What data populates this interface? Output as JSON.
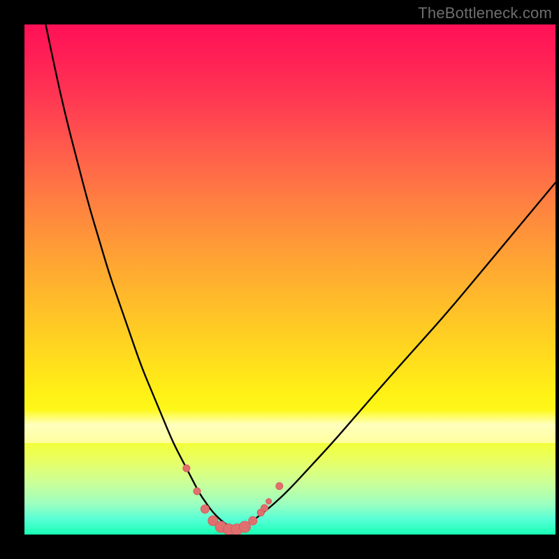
{
  "watermark": "TheBottleneck.com",
  "colors": {
    "background": "#000000",
    "curve": "#000000",
    "marker_fill": "#e07070",
    "marker_stroke": "#d85a5a"
  },
  "chart_data": {
    "type": "line",
    "title": "",
    "xlabel": "",
    "ylabel": "",
    "xlim": [
      0,
      100
    ],
    "ylim": [
      0,
      100
    ],
    "grid": false,
    "series": [
      {
        "name": "bottleneck-curve",
        "x": [
          4,
          6,
          8,
          10,
          12,
          14,
          16,
          18,
          20,
          22,
          24,
          26,
          28,
          30,
          31,
          32,
          33,
          34,
          35,
          36,
          37,
          38,
          39,
          40,
          41,
          42,
          44,
          47,
          50,
          54,
          58,
          63,
          68,
          74,
          80,
          86,
          92,
          98,
          100
        ],
        "y": [
          100,
          90,
          81,
          73,
          65,
          58,
          51,
          45,
          39,
          33,
          28,
          23,
          18,
          14,
          12,
          10,
          8,
          6.5,
          5,
          3.8,
          2.8,
          2.0,
          1.3,
          1.0,
          1.3,
          2.0,
          3.5,
          6,
          9,
          13.5,
          18,
          24,
          30,
          37,
          44,
          51.5,
          59,
          66.5,
          69
        ]
      }
    ],
    "markers": [
      {
        "x": 30.5,
        "y": 13.0,
        "r": 5
      },
      {
        "x": 32.5,
        "y": 8.5,
        "r": 5
      },
      {
        "x": 34.0,
        "y": 5.0,
        "r": 6
      },
      {
        "x": 35.5,
        "y": 2.7,
        "r": 7
      },
      {
        "x": 37.0,
        "y": 1.5,
        "r": 8
      },
      {
        "x": 38.5,
        "y": 1.0,
        "r": 8
      },
      {
        "x": 40.0,
        "y": 1.0,
        "r": 8
      },
      {
        "x": 41.5,
        "y": 1.5,
        "r": 8
      },
      {
        "x": 43.0,
        "y": 2.7,
        "r": 6
      },
      {
        "x": 44.5,
        "y": 4.3,
        "r": 5
      },
      {
        "x": 46.0,
        "y": 6.5,
        "r": 4
      },
      {
        "x": 48.0,
        "y": 9.5,
        "r": 5
      },
      {
        "x": 45.2,
        "y": 5.2,
        "r": 5
      }
    ]
  }
}
